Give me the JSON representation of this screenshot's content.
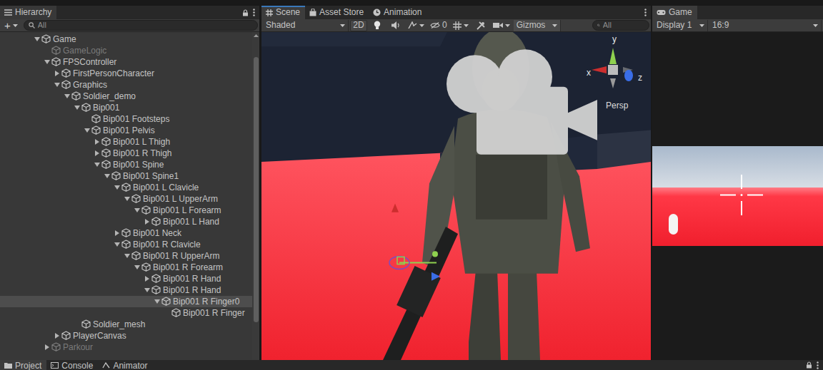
{
  "hierarchy": {
    "tab": {
      "label": "Hierarchy",
      "selected": true
    },
    "add": "+",
    "search": {
      "placeholder": "All"
    },
    "tree": [
      {
        "label": "Game",
        "expanded": true,
        "selected": false,
        "inactive": false,
        "children": [
          {
            "label": "GameLogic",
            "selected": false,
            "inactive": true,
            "children": []
          },
          {
            "label": "FPSController",
            "expanded": true,
            "selected": false,
            "inactive": false,
            "children": [
              {
                "label": "FirstPersonCharacter",
                "expanded": false,
                "selected": false,
                "inactive": false,
                "children": []
              },
              {
                "label": "Graphics",
                "expanded": true,
                "selected": false,
                "inactive": false,
                "children": [
                  {
                    "label": "Soldier_demo",
                    "expanded": true,
                    "selected": false,
                    "inactive": false,
                    "children": [
                      {
                        "label": "Bip001",
                        "expanded": true,
                        "selected": false,
                        "inactive": false,
                        "children": [
                          {
                            "label": "Bip001 Footsteps",
                            "selected": false,
                            "inactive": false,
                            "children": []
                          },
                          {
                            "label": "Bip001 Pelvis",
                            "expanded": true,
                            "selected": false,
                            "inactive": false,
                            "children": [
                              {
                                "label": "Bip001 L Thigh",
                                "expanded": false,
                                "selected": false,
                                "inactive": false,
                                "children": []
                              },
                              {
                                "label": "Bip001 R Thigh",
                                "expanded": false,
                                "selected": false,
                                "inactive": false,
                                "children": []
                              },
                              {
                                "label": "Bip001 Spine",
                                "expanded": true,
                                "selected": false,
                                "inactive": false,
                                "children": [
                                  {
                                    "label": "Bip001 Spine1",
                                    "expanded": true,
                                    "selected": false,
                                    "inactive": false,
                                    "children": [
                                      {
                                        "label": "Bip001 L Clavicle",
                                        "expanded": true,
                                        "selected": false,
                                        "inactive": false,
                                        "children": [
                                          {
                                            "label": "Bip001 L UpperArm",
                                            "expanded": true,
                                            "selected": false,
                                            "inactive": false,
                                            "children": [
                                              {
                                                "label": "Bip001 L Forearm",
                                                "expanded": true,
                                                "selected": false,
                                                "inactive": false,
                                                "children": [
                                                  {
                                                    "label": "Bip001 L Hand",
                                                    "expanded": false,
                                                    "selected": false,
                                                    "inactive": false,
                                                    "children": []
                                                  }
                                                ]
                                              }
                                            ]
                                          }
                                        ]
                                      },
                                      {
                                        "label": "Bip001 Neck",
                                        "expanded": false,
                                        "selected": false,
                                        "inactive": false,
                                        "children": []
                                      },
                                      {
                                        "label": "Bip001 R Clavicle",
                                        "expanded": true,
                                        "selected": false,
                                        "inactive": false,
                                        "children": [
                                          {
                                            "label": "Bip001 R UpperArm",
                                            "expanded": true,
                                            "selected": false,
                                            "inactive": false,
                                            "children": [
                                              {
                                                "label": "Bip001 R Forearm",
                                                "expanded": true,
                                                "selected": false,
                                                "inactive": false,
                                                "children": [
                                                  {
                                                    "label": "Bip001 R Hand",
                                                    "expanded": false,
                                                    "selected": false,
                                                    "inactive": false,
                                                    "children": []
                                                  },
                                                  {
                                                    "label": "Bip001 R Hand",
                                                    "expanded": true,
                                                    "selected": false,
                                                    "inactive": false,
                                                    "children": [
                                                      {
                                                        "label": "Bip001 R Finger0",
                                                        "expanded": true,
                                                        "selected": true,
                                                        "inactive": false,
                                                        "children": [
                                                          {
                                                            "label": "Bip001 R Finger",
                                                            "selected": false,
                                                            "inactive": false,
                                                            "children": []
                                                          }
                                                        ]
                                                      }
                                                    ]
                                                  }
                                                ]
                                              }
                                            ]
                                          }
                                        ]
                                      }
                                    ]
                                  }
                                ]
                              }
                            ]
                          }
                        ]
                      },
                      {
                        "label": "Soldier_mesh",
                        "selected": false,
                        "inactive": false,
                        "children": []
                      }
                    ]
                  }
                ]
              },
              {
                "label": "PlayerCanvas",
                "expanded": false,
                "selected": false,
                "inactive": false,
                "children": []
              }
            ]
          },
          {
            "label": "Parkour",
            "expanded": false,
            "selected": false,
            "inactive": true,
            "children": []
          }
        ]
      }
    ]
  },
  "scene_panel": {
    "focused": true,
    "tabs": [
      {
        "label": "Scene",
        "selected": true
      },
      {
        "label": "Asset Store",
        "selected": false
      },
      {
        "label": "Animation",
        "selected": false
      }
    ],
    "toolbar": {
      "shading": "Shaded",
      "mode_2d": {
        "label": "2D",
        "on": false
      },
      "hidden_count": "0",
      "gizmos": {
        "label": "Gizmos",
        "on": true
      },
      "search": {
        "placeholder": "All"
      }
    },
    "view": {
      "axes": [
        {
          "label": "y",
          "color": "#8fd14f"
        },
        {
          "label": "x",
          "color": "#cc2e2e"
        },
        {
          "label": "z",
          "color": "#3a6ee8"
        }
      ],
      "projection": "Persp"
    }
  },
  "game_panel": {
    "tab": {
      "label": "Game",
      "selected": true
    },
    "display": "Display 1",
    "aspect": "16:9"
  },
  "bottom_tabs": [
    {
      "label": "Project",
      "selected": true
    },
    {
      "label": "Console",
      "selected": false
    },
    {
      "label": "Animator",
      "selected": false
    }
  ]
}
